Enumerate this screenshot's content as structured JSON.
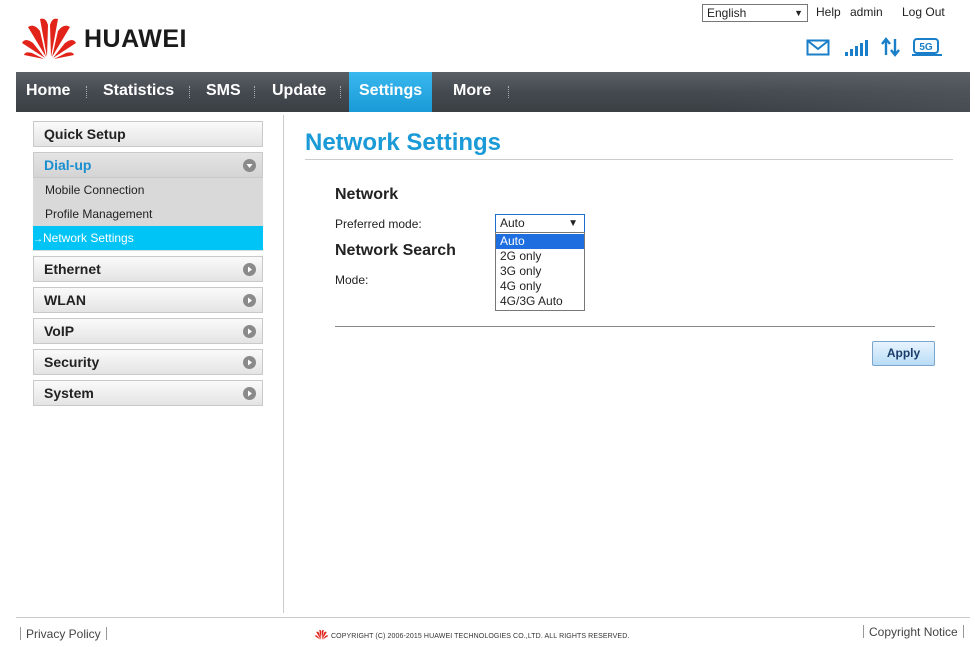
{
  "header": {
    "brand": "HUAWEI",
    "language_value": "English",
    "links": {
      "help": "Help",
      "user": "admin",
      "logout": "Log Out"
    },
    "status_icons": [
      "envelope-icon",
      "signal-bars-icon",
      "data-transfer-icon",
      "network-5g-icon"
    ],
    "status_icon_text": "5G"
  },
  "nav": {
    "items": [
      {
        "label": "Home",
        "active": false
      },
      {
        "label": "Statistics",
        "active": false
      },
      {
        "label": "SMS",
        "active": false
      },
      {
        "label": "Update",
        "active": false
      },
      {
        "label": "Settings",
        "active": true
      },
      {
        "label": "More",
        "active": false
      }
    ],
    "active_color": "#1a9ad6"
  },
  "sidebar": {
    "quick_setup": "Quick Setup",
    "dialup": {
      "label": "Dial-up",
      "subitems": [
        "Mobile Connection",
        "Profile Management",
        "Network Settings"
      ],
      "active_subitem": "Network Settings"
    },
    "groups": [
      "Ethernet",
      "WLAN",
      "VoIP",
      "Security",
      "System"
    ]
  },
  "main": {
    "title": "Network Settings",
    "network_section": "Network",
    "preferred_mode_label": "Preferred mode:",
    "preferred_mode_value": "Auto",
    "preferred_mode_options": [
      "Auto",
      "2G only",
      "3G only",
      "4G only",
      "4G/3G Auto"
    ],
    "network_search_section": "Network Search",
    "mode_label": "Mode:",
    "apply_label": "Apply"
  },
  "footer": {
    "privacy": "Privacy Policy",
    "copyright": "COPYRIGHT (C) 2006-2015 HUAWEI TECHNOLOGIES CO.,LTD. ALL RIGHTS RESERVED.",
    "copyright_notice": "Copyright Notice"
  },
  "colors": {
    "accent": "#1a9ad6",
    "brand_red": "#e2231a",
    "selected_option": "#1e6ee0",
    "sidebar_active": "#00c4f5"
  }
}
